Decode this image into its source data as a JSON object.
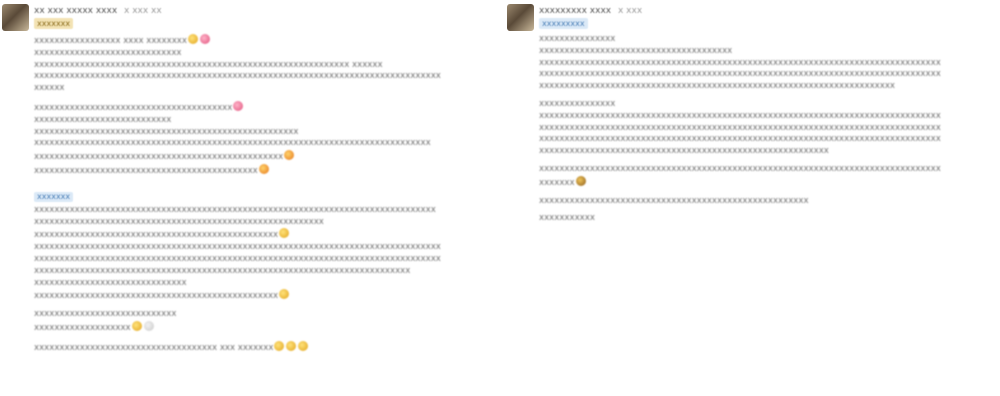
{
  "left_post": {
    "author": "xx xxx xxxxx xxxx",
    "meta": "x xxx xx",
    "tag": "xxxxxxx",
    "blocks": [
      {
        "lines": [
          "xxxxxxxxxxxxxxxxx xxxx xxxxxxxx",
          "xxxxxxxxxxxxxxxxxxxxxxxxxxxxx",
          "xxxxxxxxxxxxxxxxxxxxxxxxxxxxxxxxxxxxxxxxxxxxxxxxxxxxxxxxxxxxxx xxxxxx",
          "xxxxxxxxxxxxxxxxxxxxxxxxxxxxxxxxxxxxxxxxxxxxxxxxxxxxxxxxxxxxxxxxxxxxxxxxxxxxxxxx",
          "xxxxxx"
        ]
      },
      {
        "lines": [
          "xxxxxxxxxxxxxxxxxxxxxxxxxxxxxxxxxxxxxxx",
          "xxxxxxxxxxxxxxxxxxxxxxxxxxx",
          "xxxxxxxxxxxxxxxxxxxxxxxxxxxxxxxxxxxxxxxxxxxxxxxxxxxx",
          "xxxxxxxxxxxxxxxxxxxxxxxxxxxxxxxxxxxxxxxxxxxxxxxxxxxxxxxxxxxxxxxxxxxxxxxxxxxxxx",
          "xxxxxxxxxxxxxxxxxxxxxxxxxxxxxxxxxxxxxxxxxxxxxxxxx",
          "xxxxxxxxxxxxxxxxxxxxxxxxxxxxxxxxxxxxxxxxxxxx"
        ]
      },
      {
        "sub_tag": "xxxxxxx",
        "lines": [
          "xxxxxxxxxxxxxxxxxxxxxxxxxxxxxxxxxxxxxxxxxxxxxxxxxxxxxxxxxxxxxxxxxxxxxxxxxxxxxxx",
          "xxxxxxxxxxxxxxxxxxxxxxxxxxxxxxxxxxxxxxxxxxxxxxxxxxxxxxxxx",
          "xxxxxxxxxxxxxxxxxxxxxxxxxxxxxxxxxxxxxxxxxxxxxxxx",
          "xxxxxxxxxxxxxxxxxxxxxxxxxxxxxxxxxxxxxxxxxxxxxxxxxxxxxxxxxxxxxxxxxxxxxxxxxxxxxxxx",
          "xxxxxxxxxxxxxxxxxxxxxxxxxxxxxxxxxxxxxxxxxxxxxxxxxxxxxxxxxxxxxxxxxxxxxxxxxxxxxxxx",
          "xxxxxxxxxxxxxxxxxxxxxxxxxxxxxxxxxxxxxxxxxxxxxxxxxxxxxxxxxxxxxxxxxxxxxxxxxx",
          "xxxxxxxxxxxxxxxxxxxxxxxxxxxxxx",
          "xxxxxxxxxxxxxxxxxxxxxxxxxxxxxxxxxxxxxxxxxxxxxxxx"
        ]
      },
      {
        "lines": [
          "xxxxxxxxxxxxxxxxxxxxxxxxxxxx",
          "xxxxxxxxxxxxxxxxxxx"
        ]
      },
      {
        "lines": [
          "xxxxxxxxxxxxxxxxxxxxxxxxxxxxxxxxxxxx xxx xxxxxxx"
        ]
      }
    ]
  },
  "right_post": {
    "author": "xxxxxxxxx xxxx",
    "meta": "x xxx",
    "tag": "xxxxxxxxx",
    "blocks": [
      {
        "lines": [
          "xxxxxxxxxxxxxxx",
          "xxxxxxxxxxxxxxxxxxxxxxxxxxxxxxxxxxxxxx",
          "xxxxxxxxxxxxxxxxxxxxxxxxxxxxxxxxxxxxxxxxxxxxxxxxxxxxxxxxxxxxxxxxxxxxxxxxxxxxxxx",
          "xxxxxxxxxxxxxxxxxxxxxxxxxxxxxxxxxxxxxxxxxxxxxxxxxxxxxxxxxxxxxxxxxxxxxxxxxxxxxxx",
          "xxxxxxxxxxxxxxxxxxxxxxxxxxxxxxxxxxxxxxxxxxxxxxxxxxxxxxxxxxxxxxxxxxxxxx"
        ]
      },
      {
        "lines": [
          "xxxxxxxxxxxxxxx",
          "xxxxxxxxxxxxxxxxxxxxxxxxxxxxxxxxxxxxxxxxxxxxxxxxxxxxxxxxxxxxxxxxxxxxxxxxxxxxxxx",
          "xxxxxxxxxxxxxxxxxxxxxxxxxxxxxxxxxxxxxxxxxxxxxxxxxxxxxxxxxxxxxxxxxxxxxxxxxxxxxxx",
          "xxxxxxxxxxxxxxxxxxxxxxxxxxxxxxxxxxxxxxxxxxxxxxxxxxxxxxxxxxxxxxxxxxxxxxxxxxxxxxx",
          "xxxxxxxxxxxxxxxxxxxxxxxxxxxxxxxxxxxxxxxxxxxxxxxxxxxxxxxxx"
        ]
      },
      {
        "lines": [
          "xxxxxxxxxxxxxxxxxxxxxxxxxxxxxxxxxxxxxxxxxxxxxxxxxxxxxxxxxxxxxxxxxxxxxxxxxxxxxxx",
          "xxxxxxx"
        ]
      },
      {
        "lines": [
          "xxxxxxxxxxxxxxxxxxxxxxxxxxxxxxxxxxxxxxxxxxxxxxxxxxxxx"
        ]
      },
      {
        "lines": [
          "xxxxxxxxxxx"
        ]
      }
    ]
  },
  "colors": {
    "gold_tag_bg": "#f3e3b4",
    "blue_tag_bg": "#dbe9f7",
    "text": "#6d6d6d"
  },
  "icons": [
    "avatar",
    "gold-emoji-icon",
    "pink-emoji-icon",
    "fire-emoji-icon",
    "grey-emoji-icon"
  ]
}
